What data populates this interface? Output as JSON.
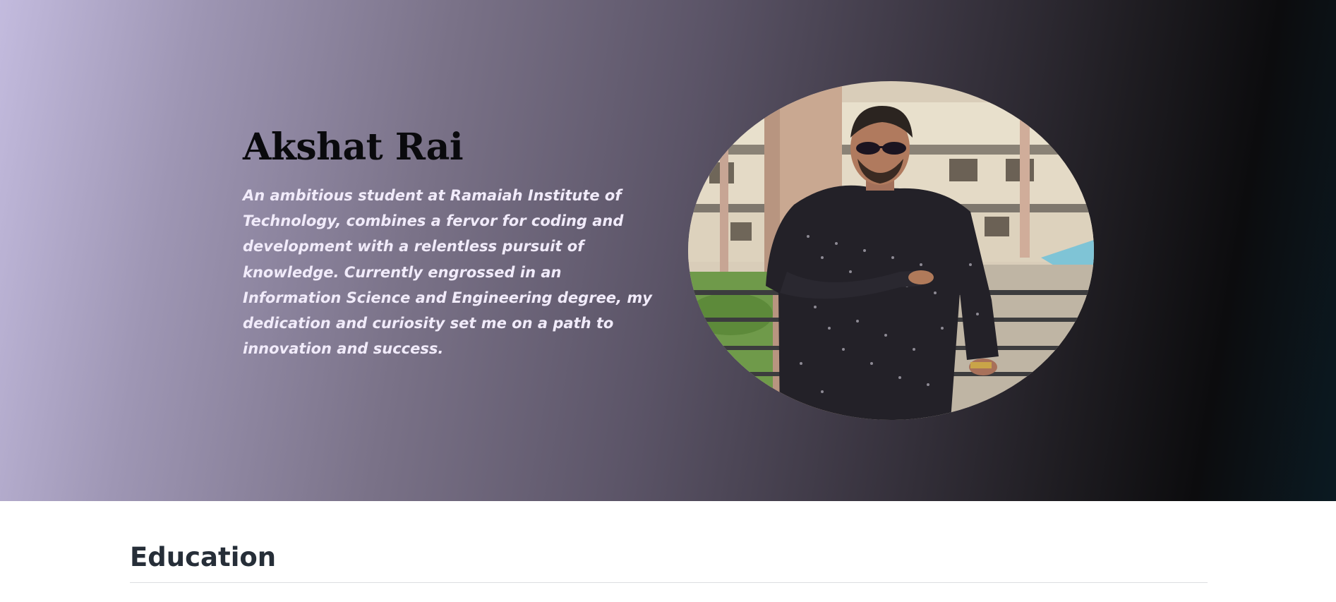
{
  "hero": {
    "name": "Akshat Rai",
    "bio": "An ambitious student at Ramaiah Institute of Technology, combines a fervor for coding and development with a relentless pursuit of knowledge. Currently engrossed in an Information Science and Engineering degree, my dedication and curiosity set me on a path to innovation and success.",
    "gradient_colors": [
      "#c3bbde",
      "#7a7288",
      "#3b3642",
      "#0c0c0e",
      "#0b1a22"
    ],
    "title_color": "#0a0a0d",
    "bio_color": "#f1ebfa"
  },
  "portrait": {
    "icon": "profile-photo"
  },
  "education": {
    "heading": "Education"
  }
}
